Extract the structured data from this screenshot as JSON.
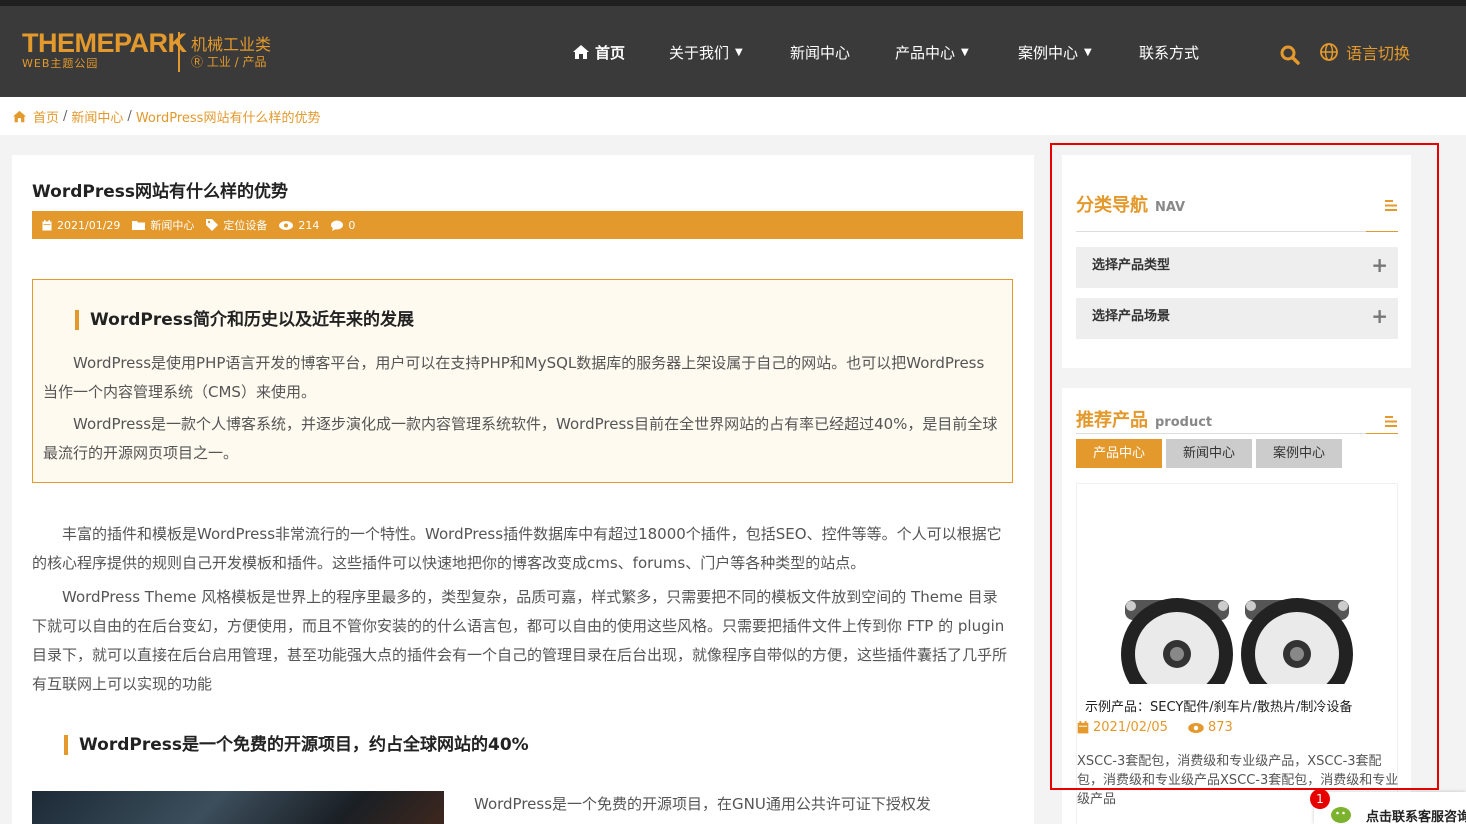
{
  "header": {
    "logo_main": "THEMEPARK",
    "logo_sub": "WEB主题公园",
    "category": "机械工业类",
    "category_sub": "工业 / 产品",
    "nav": [
      {
        "label": "首页"
      },
      {
        "label": "关于我们"
      },
      {
        "label": "新闻中心"
      },
      {
        "label": "产品中心"
      },
      {
        "label": "案例中心"
      },
      {
        "label": "联系方式"
      }
    ],
    "language": "语言切换"
  },
  "breadcrumb": {
    "home": "首页",
    "sep": "/",
    "section": "新闻中心",
    "current": "WordPress网站有什么样的优势"
  },
  "article": {
    "title": "WordPress网站有什么样的优势",
    "meta": {
      "date": "2021/01/29",
      "category": "新闻中心",
      "tag": "定位设备",
      "views": "214",
      "comments": "0"
    },
    "intro_heading": "WordPress简介和历史以及近年来的发展",
    "intro_p1": "　　WordPress是使用PHP语言开发的博客平台，用户可以在支持PHP和MySQL数据库的服务器上架设属于自己的网站。也可以把WordPress当作一个内容管理系统（CMS）来使用。",
    "intro_p2": "　　WordPress是一款个人博客系统，并逐步演化成一款内容管理系统软件，WordPress目前在全世界网站的占有率已经超过40%，是目前全球最流行的开源网页项目之一。",
    "body_p1": "　　丰富的插件和模板是WordPress非常流行的一个特性。WordPress插件数据库中有超过18000个插件，包括SEO、控件等等。个人可以根据它的核心程序提供的规则自己开发模板和插件。这些插件可以快速地把你的博客改变成cms、forums、门户等各种类型的站点。",
    "body_p2": "　　WordPress Theme 风格模板是世界上的程序里最多的，类型复杂，品质可嘉，样式繁多，只需要把不同的模板文件放到空间的 Theme 目录下就可以自由的在后台变幻，方便使用，而且不管你安装的的什么语言包，都可以自由的使用这些风格。只需要把插件文件上传到你 FTP 的 plugin 目录下，就可以直接在后台启用管理，甚至功能强大点的插件会有一个自己的管理目录在后台出现，就像程序自带似的方便，这些插件囊括了几乎所有互联网上可以实现的功能",
    "heading2": "WordPress是一个免费的开源项目，约占全球网站的40%",
    "body_p3": "WordPress是一个免费的开源项目，在GNU通用公共许可证下授权发"
  },
  "sidebar": {
    "nav_title": "分类导航",
    "nav_title_en": "NAV",
    "categories": [
      {
        "label": "选择产品类型"
      },
      {
        "label": "选择产品场景"
      }
    ],
    "rec_title": "推荐产品",
    "rec_title_en": "product",
    "tabs": [
      {
        "label": "产品中心"
      },
      {
        "label": "新闻中心"
      },
      {
        "label": "案例中心"
      }
    ],
    "product": {
      "name": "示例产品：SECY配件/刹车片/散热片/制冷设备",
      "date": "2021/02/05",
      "views": "873",
      "desc": "XSCC-3套配包，消费级和专业级产品，XSCC-3套配包，消费级和专业级产品XSCC-3套配包，消费级和专业级产品"
    }
  },
  "chat": {
    "badge": "1",
    "label": "点击联系客服咨询"
  },
  "colors": {
    "accent": "#e3992c",
    "header_bg": "#3a3a3a",
    "highlight": "#e60000"
  }
}
